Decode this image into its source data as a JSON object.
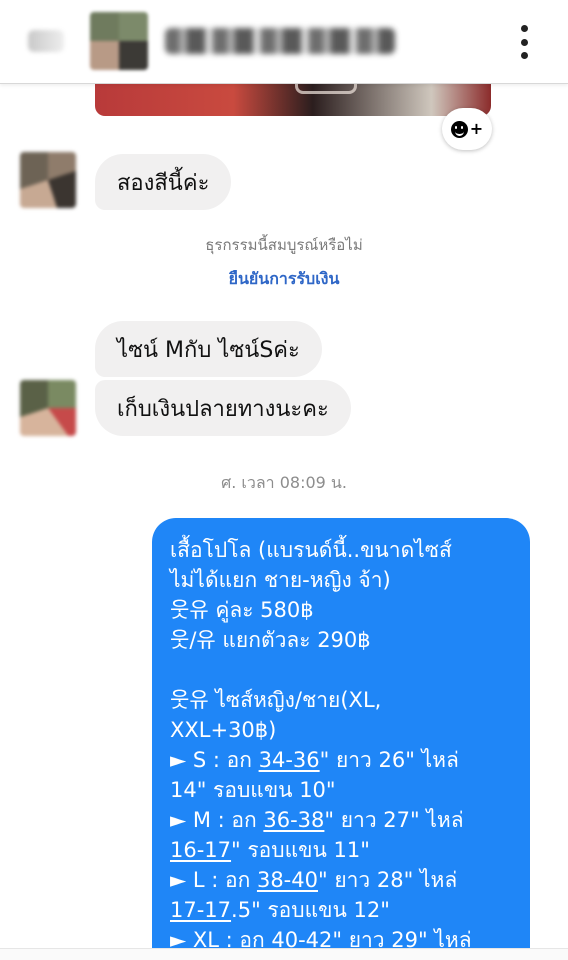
{
  "header": {
    "back_icon": "back-arrow-icon",
    "menu_icon": "more-vert-icon"
  },
  "thread": {
    "m1": "สองสีนี้ค่ะ",
    "system_question": "ธุรกรรมนี้สมบูรณ์หรือไม่",
    "system_link": "ยืนยันการรับเงิน",
    "m2": "ไซน์ Mกับ ไซน์Sค่ะ",
    "m3": "เก็บเงินปลายทางนะคะ",
    "timestamp": "ศ. เวลา 08:09 น."
  },
  "outgoing": {
    "l1": "เสื้อโปโล  (แบรนด์นี้..ขนาดไซส์",
    "l2": "ไม่ได้แยก ชาย-หญิง จ้า)",
    "l3": "웃유 คู่ละ 580฿",
    "l4": "웃/유 แยกตัวละ 290฿",
    "l6": "웃유 ไซส์หญิง/ชาย(XL,",
    "l7": "XXL+30฿)",
    "s_pre": "► S : อก ",
    "s_chest": "34-36",
    "s_post": "\" ยาว 26\" ไหล่",
    "s_line2": "14\" รอบแขน 10\"",
    "m_pre": "► M : อก ",
    "m_chest": "36-38",
    "m_post": "\" ยาว 27\" ไหล่",
    "m_shoulder": "16-17",
    "m_line2": "\" รอบแขน 11\"",
    "l_pre": "► L : อก ",
    "l_chest": "38-40",
    "l_post": "\" ยาว 28\" ไหล่",
    "l_shoulder": "17-17",
    "l_line2": ".5\" รอบแขน 12\"",
    "xl_pre": "► XL : อก ",
    "xl_chest": "40-42",
    "xl_post": "\" ยาว 29\" ไหล่"
  },
  "colors": {
    "outgoing_bubble": "#1f86f7",
    "incoming_bubble": "#f1f0f0",
    "link": "#2f67c7"
  }
}
